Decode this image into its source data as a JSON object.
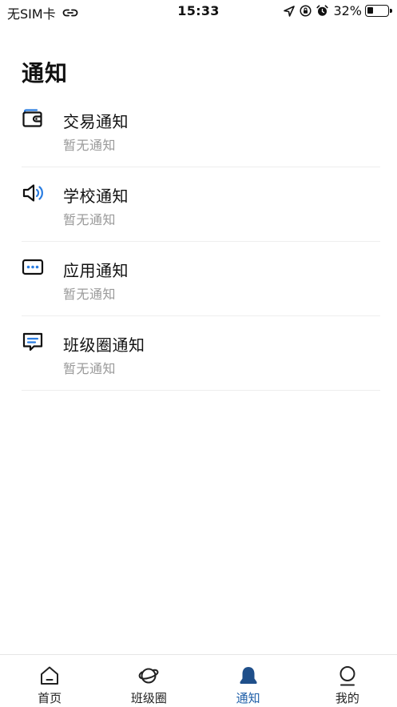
{
  "status_bar": {
    "carrier": "无SIM卡",
    "time": "15:33",
    "battery": "32%",
    "battery_level": 0.32
  },
  "page": {
    "title": "通知"
  },
  "notifications": [
    {
      "title": "交易通知",
      "subtitle": "暂无通知",
      "icon": "wallet-icon"
    },
    {
      "title": "学校通知",
      "subtitle": "暂无通知",
      "icon": "speaker-icon"
    },
    {
      "title": "应用通知",
      "subtitle": "暂无通知",
      "icon": "dots-message-icon"
    },
    {
      "title": "班级圈通知",
      "subtitle": "暂无通知",
      "icon": "chat-lines-icon"
    }
  ],
  "tabs": [
    {
      "label": "首页",
      "icon": "home-icon"
    },
    {
      "label": "班级圈",
      "icon": "planet-icon"
    },
    {
      "label": "通知",
      "icon": "bell-icon"
    },
    {
      "label": "我的",
      "icon": "person-icon"
    }
  ],
  "colors": {
    "accent": "#1f5fa8",
    "icon_blue": "#2a7de1",
    "subtitle_gray": "#9a9a9a",
    "divider": "#eeeeee"
  }
}
